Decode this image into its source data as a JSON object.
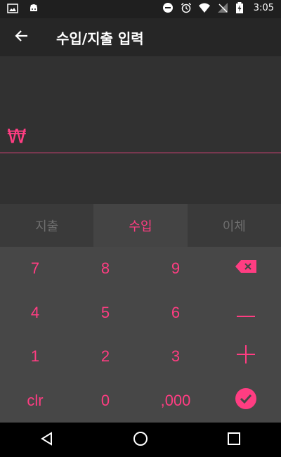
{
  "status_bar": {
    "time": "3:05",
    "left_icons": [
      "image-icon",
      "android-icon"
    ],
    "right_icons": [
      "do-not-disturb-icon",
      "alarm-icon",
      "wifi-icon",
      "no-signal-icon",
      "battery-charging-icon"
    ]
  },
  "app_bar": {
    "title": "수입/지출 입력",
    "back_icon": "arrow-back-icon"
  },
  "amount": {
    "currency_symbol": "₩",
    "value": ""
  },
  "tabs": [
    {
      "label": "지출",
      "active": false
    },
    {
      "label": "수입",
      "active": true
    },
    {
      "label": "이체",
      "active": false
    }
  ],
  "keypad": {
    "row1": [
      "7",
      "8",
      "9"
    ],
    "row2": [
      "4",
      "5",
      "6"
    ],
    "row3": [
      "1",
      "2",
      "3"
    ],
    "row4": [
      "clr",
      "0",
      ",000"
    ],
    "side_icons": [
      "backspace-icon",
      "minus-icon",
      "plus-icon",
      "check-circle-icon"
    ]
  },
  "colors": {
    "accent": "#ff3d82",
    "background": "#2d2d2d",
    "keypad_bg": "#474747"
  },
  "nav_bar": {
    "icons": [
      "back-triangle-icon",
      "home-circle-icon",
      "recents-square-icon"
    ]
  }
}
